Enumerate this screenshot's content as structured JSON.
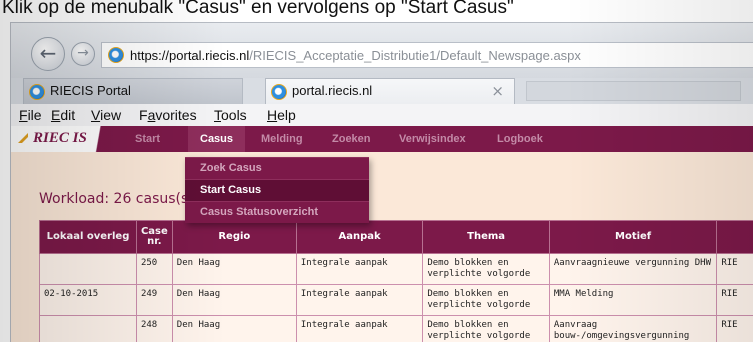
{
  "caption": "Klik op de menubalk \"Casus\" en vervolgens op \"Start Casus\"",
  "browser": {
    "url_protocol": "https://",
    "url_host": "portal.riecis.nl",
    "url_path": "/RIECIS_Acceptatie_Distributie1/Default_Newspage.aspx",
    "tabs": [
      {
        "title": "RIECIS Portal"
      },
      {
        "title": "portal.riecis.nl",
        "close": "×"
      }
    ]
  },
  "menubar": [
    {
      "key": "F",
      "rest": "ile"
    },
    {
      "key": "E",
      "rest": "dit"
    },
    {
      "key": "V",
      "rest": "iew"
    },
    {
      "key": "a",
      "pre": "F",
      "rest": "vorites"
    },
    {
      "key": "T",
      "rest": "ools"
    },
    {
      "key": "H",
      "rest": "elp"
    }
  ],
  "app": {
    "logo": "RIEC IS",
    "nav": [
      "Start",
      "Casus",
      "Melding",
      "Zoeken",
      "Verwijsindex",
      "Logboek"
    ],
    "active_nav": "Casus",
    "dropdown": [
      "Zoek Casus",
      "Start Casus",
      "Casus Statusoverzicht"
    ],
    "dropdown_hover": "Start Casus",
    "workload": "Workload: 26 casus(se",
    "table": {
      "headers": [
        "Lokaal overleg",
        "Case nr.",
        "Regio",
        "Aanpak",
        "Thema",
        "Motief",
        ""
      ],
      "rows": [
        [
          "",
          "250",
          "Den Haag",
          "Integrale aanpak",
          "Demo blokken en verplichte volgorde",
          "Aanvraagnieuwe vergunning DHW",
          "RIE"
        ],
        [
          "02-10-2015",
          "249",
          "Den Haag",
          "Integrale aanpak",
          "Demo blokken en verplichte volgorde",
          "MMA Melding",
          "RIE"
        ],
        [
          "",
          "248",
          "Den Haag",
          "Integrale aanpak",
          "Demo blokken en verplichte volgorde",
          "Aanvraag bouw-/omgevingsvergunning",
          "RIE"
        ]
      ]
    }
  },
  "colors": {
    "brand": "#7c1949",
    "content_bg": "#fbe8d8"
  },
  "icons": {
    "back": "back-arrow-icon",
    "forward": "forward-arrow-icon",
    "browser": "ie-icon"
  }
}
